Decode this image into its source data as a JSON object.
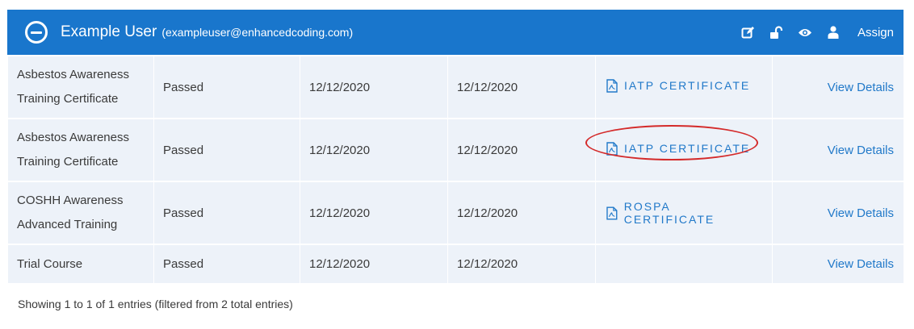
{
  "header": {
    "user_name": "Example User",
    "user_email": "(exampleuser@enhancedcoding.com)",
    "assign_label": "Assign",
    "icons": [
      "edit-icon",
      "unlock-icon",
      "eye-icon",
      "user-icon"
    ],
    "background_color": "#1976cc"
  },
  "rows": [
    {
      "course_line1": "Asbestos Awareness",
      "course_line2": "Training Certificate",
      "status": "Passed",
      "date1": "12/12/2020",
      "date2": "12/12/2020",
      "certificate": "IATP CERTIFICATE",
      "details": "View Details"
    },
    {
      "course_line1": "Asbestos Awareness",
      "course_line2": "Training Certificate",
      "status": "Passed",
      "date1": "12/12/2020",
      "date2": "12/12/2020",
      "certificate": "IATP CERTIFICATE",
      "details": "View Details"
    },
    {
      "course_line1": "COSHH Awareness",
      "course_line2": "Advanced Training",
      "status": "Passed",
      "date1": "12/12/2020",
      "date2": "12/12/2020",
      "certificate": "ROSPA CERTIFICATE",
      "details": "View Details"
    },
    {
      "course_line1": "Trial Course",
      "course_line2": "",
      "status": "Passed",
      "date1": "12/12/2020",
      "date2": "12/12/2020",
      "certificate": "",
      "details": "View Details"
    }
  ],
  "footer": {
    "entries_info": "Showing 1 to 1 of 1 entries (filtered from 2 total entries)"
  },
  "colors": {
    "link": "#2179c9",
    "row_background": "#edf2f9",
    "highlight": "#d42a2a"
  }
}
